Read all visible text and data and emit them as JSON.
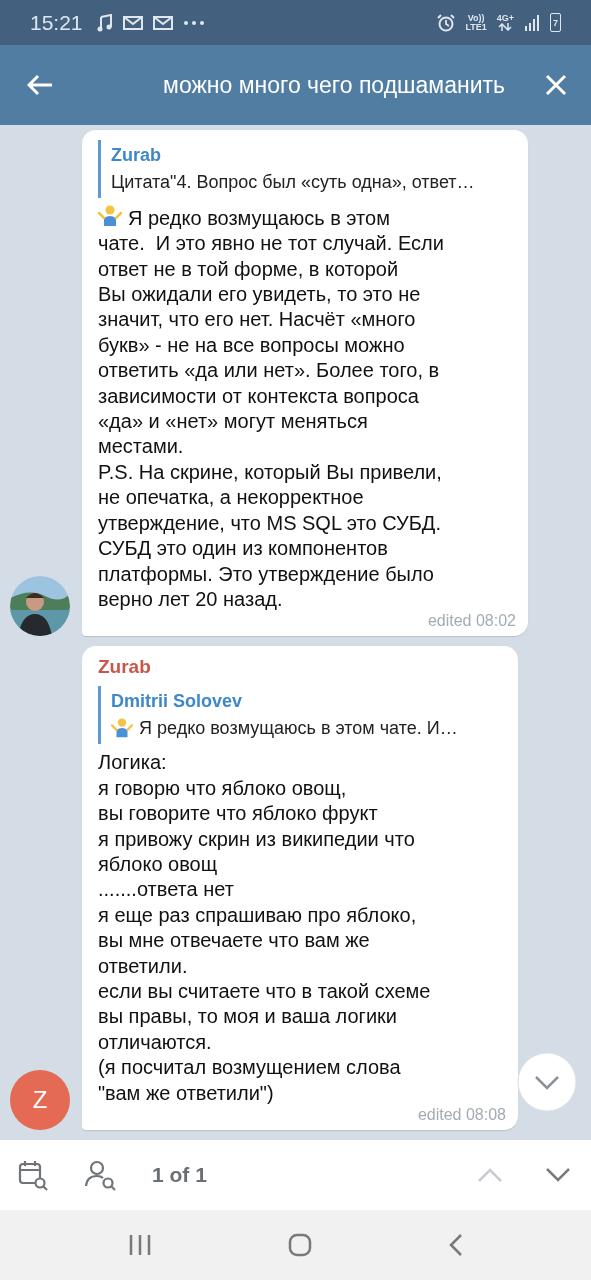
{
  "status_bar": {
    "time": "15:21",
    "volte": "Vo))",
    "lte": "LTE1",
    "network": "4G+",
    "battery": "7"
  },
  "header": {
    "search_query": "можно много чего подшаманить"
  },
  "messages": [
    {
      "reply": {
        "author": "Zurab",
        "text": "Цитата\"4. Вопрос был «суть одна», ответ…"
      },
      "emoji": true,
      "text": "Я редко возмущаюсь в этом\nчате.  И это явно не тот случай. Если\nответ не в той форме, в которой\nВы ожидали его увидеть, то это не\nзначит, что его нет. Насчёт «много\nбукв» - не на все вопросы можно\nответить «да или нет». Более того, в\nзависимости от контекста вопроса\n«да» и «нет» могут меняться\nместами.\nP.S. На скрине, который Вы привели,\nне опечатка, а некорректное\nутверждение, что MS SQL это СУБД.\nСУБД это один из компонентов\nплатформы. Это утверждение было\nверно лет 20 назад.",
      "time": "edited 08:02"
    },
    {
      "author": "Zurab",
      "avatar": {
        "kind": "letter",
        "letter": "Z",
        "color": "#e56a54"
      },
      "reply": {
        "author": "Dmitrii Solovev",
        "emoji": true,
        "text": "Я редко возмущаюсь в этом чате.  И…"
      },
      "text": "Логика:\nя говорю что яблоко овощ,\nвы говорите что яблоко фрукт\nя привожу скрин из википедии что\nяблоко овощ\n.......ответа нет\nя еще раз спрашиваю про яблоко,\nвы мне отвечаете что вам же\nответили.\nесли вы считаете что в такой схеме\nвы правы, то моя и ваша логики\nотличаются.\n(я посчитал возмущением слова\n\"вам же ответили\")",
      "time": "edited 08:08"
    }
  ],
  "search_bar": {
    "counter": "1 of 1",
    "up_disabled": true,
    "down_disabled": false
  }
}
